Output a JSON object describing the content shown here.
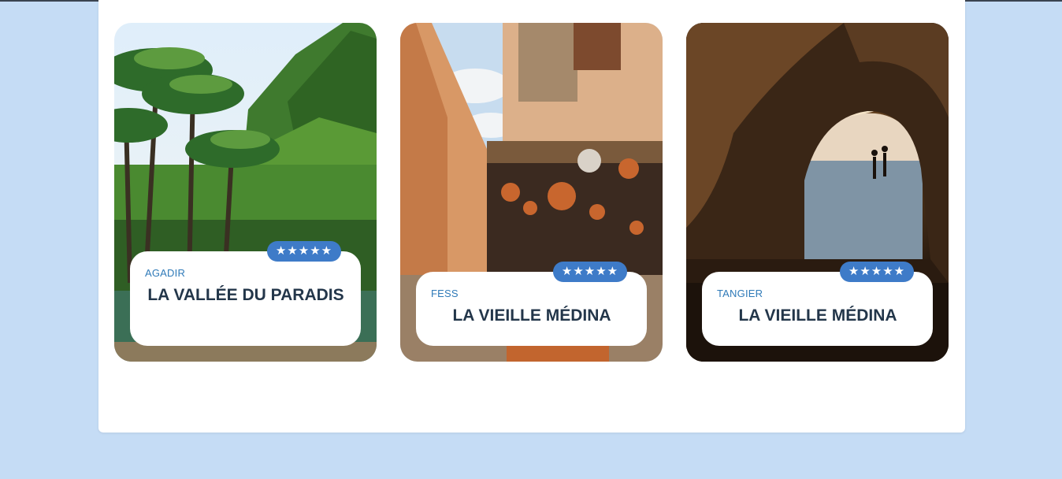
{
  "colors": {
    "page_background": "#c5dcf5",
    "panel_background": "#ffffff",
    "city_text": "#2f7ab8",
    "title_text": "#23364a",
    "rating_badge": "#3e7bc8"
  },
  "cards": [
    {
      "city": "AGADIR",
      "title": "LA VALLÉE DU PARADIS",
      "rating_stars": "★★★★★",
      "rating_value": 5,
      "image": "palm-valley-photo"
    },
    {
      "city": "FESS",
      "title": "LA VIEILLE MÉDINA",
      "rating_stars": "★★★★★",
      "rating_value": 5,
      "image": "medina-market-photo"
    },
    {
      "city": "TANGIER",
      "title": "LA VIEILLE MÉDINA",
      "rating_stars": "★★★★★",
      "rating_value": 5,
      "image": "sea-cave-photo"
    }
  ]
}
